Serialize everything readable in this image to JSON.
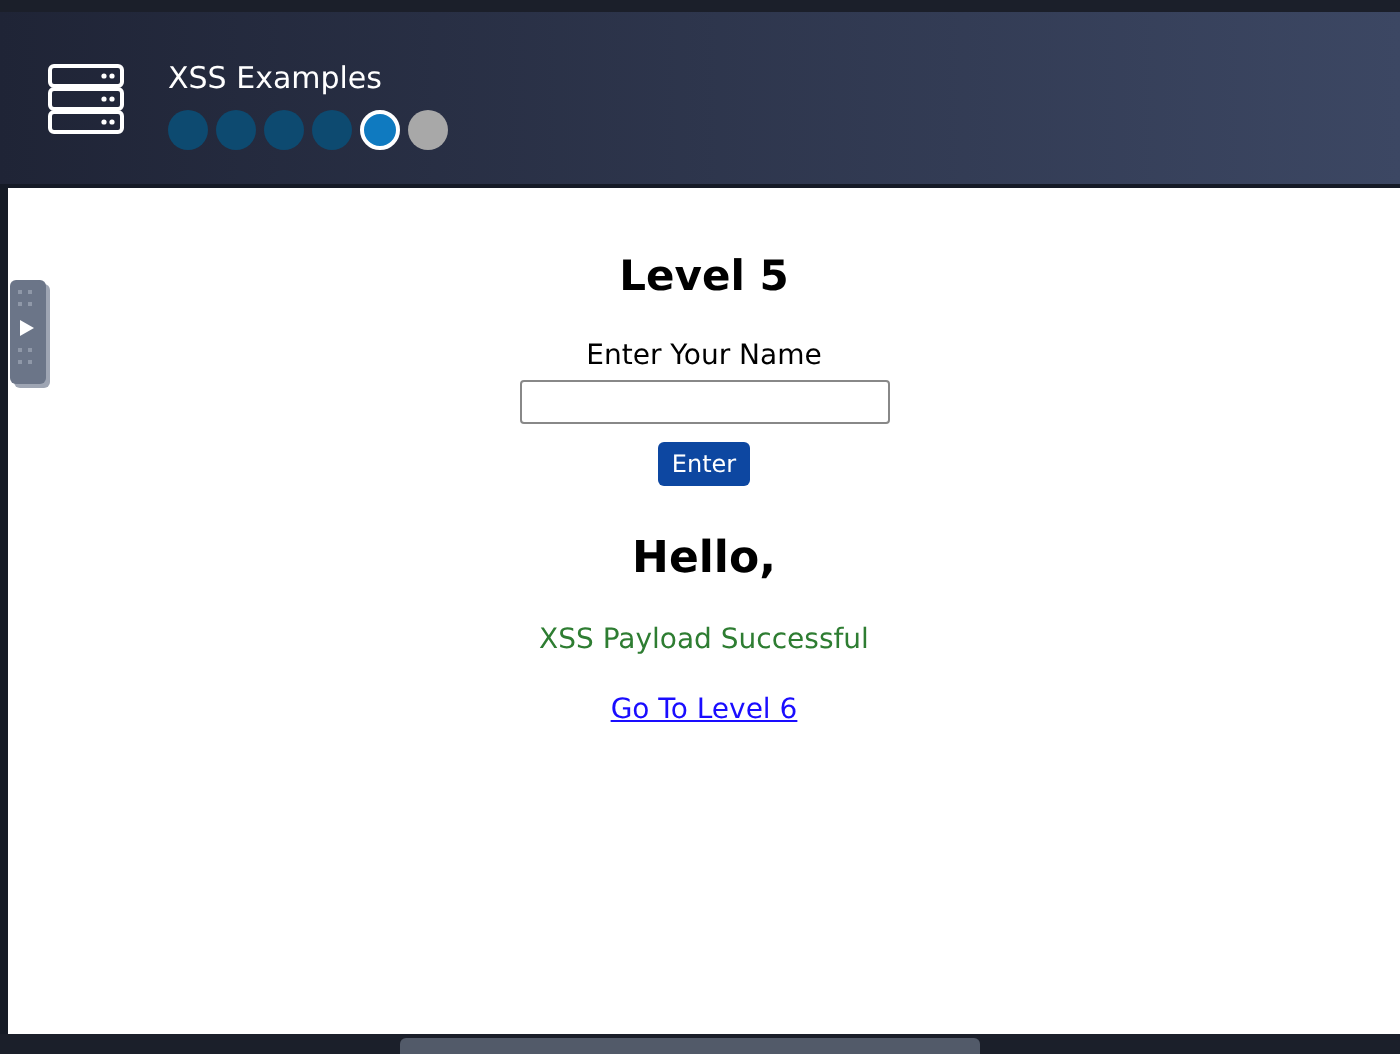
{
  "header": {
    "title": "XSS Examples",
    "levels": [
      {
        "completed": true,
        "selected": false
      },
      {
        "completed": true,
        "selected": false
      },
      {
        "completed": true,
        "selected": false
      },
      {
        "completed": true,
        "selected": false
      },
      {
        "completed": false,
        "selected": true
      },
      {
        "completed": false,
        "selected": false
      }
    ]
  },
  "main": {
    "heading": "Level 5",
    "label": "Enter Your Name",
    "button": "Enter",
    "greeting": "Hello,",
    "message": "XSS Payload Successful",
    "link": "Go To Level 6"
  }
}
